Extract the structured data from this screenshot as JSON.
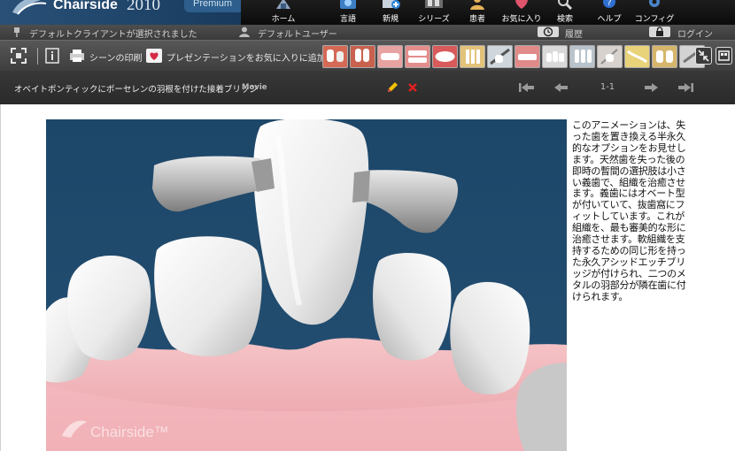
{
  "app": {
    "logo_name": "Chairside",
    "logo_year": "2010",
    "logo_tag": "Premium"
  },
  "nav": [
    {
      "label": "ホーム",
      "icon": "home-icon"
    },
    {
      "label": "言語",
      "icon": "language-icon"
    },
    {
      "label": "新規",
      "icon": "new-icon"
    },
    {
      "label": "シリーズ",
      "icon": "series-icon"
    },
    {
      "label": "患者",
      "icon": "patient-icon"
    },
    {
      "label": "お気に入り",
      "icon": "favorites-icon"
    },
    {
      "label": "検索",
      "icon": "search-icon"
    },
    {
      "label": "ヘルプ",
      "icon": "help-icon"
    },
    {
      "label": "コンフィグ",
      "icon": "config-icon"
    }
  ],
  "status": {
    "client_text": "デフォルトクライアントが選択されました",
    "user_text": "デフォルトユーザー",
    "history_label": "履歴",
    "login_label": "ログイン"
  },
  "toolbar": {
    "print_label": "シーンの印刷",
    "presentation_label": "プレゼンテーションをお気に入りに追加",
    "thumbnails_count_label": ""
  },
  "scene": {
    "title": "オベイトポンティックにポーセレンの羽根を付けた接着ブリッジ",
    "tag": "Movie",
    "pager": "1-1"
  },
  "description": "このアニメーションは、失った歯を置き換える半永久的なオプションをお見せします。天然歯を失った後の即時の暫間の選択肢は小さい義歯で、組織を治癒させます。義歯にはオベート型が付いていて、抜歯窩にフィットしています。これが組織を、最も審美的な形に治癒させます。軟組織を支持するための同じ形を持った永久アシッドエッチブリッジが付けられ、二つのメタルの羽部分が隣在歯に付けられます。",
  "illustration": {
    "watermark": "Chairside™"
  },
  "colors": {
    "brand_blue": "#1f4468",
    "illustration_bg": "#1f4a6e",
    "gum": "#f2b6bc",
    "delete_red": "#e02020",
    "edit_yellow": "#f2c200"
  }
}
